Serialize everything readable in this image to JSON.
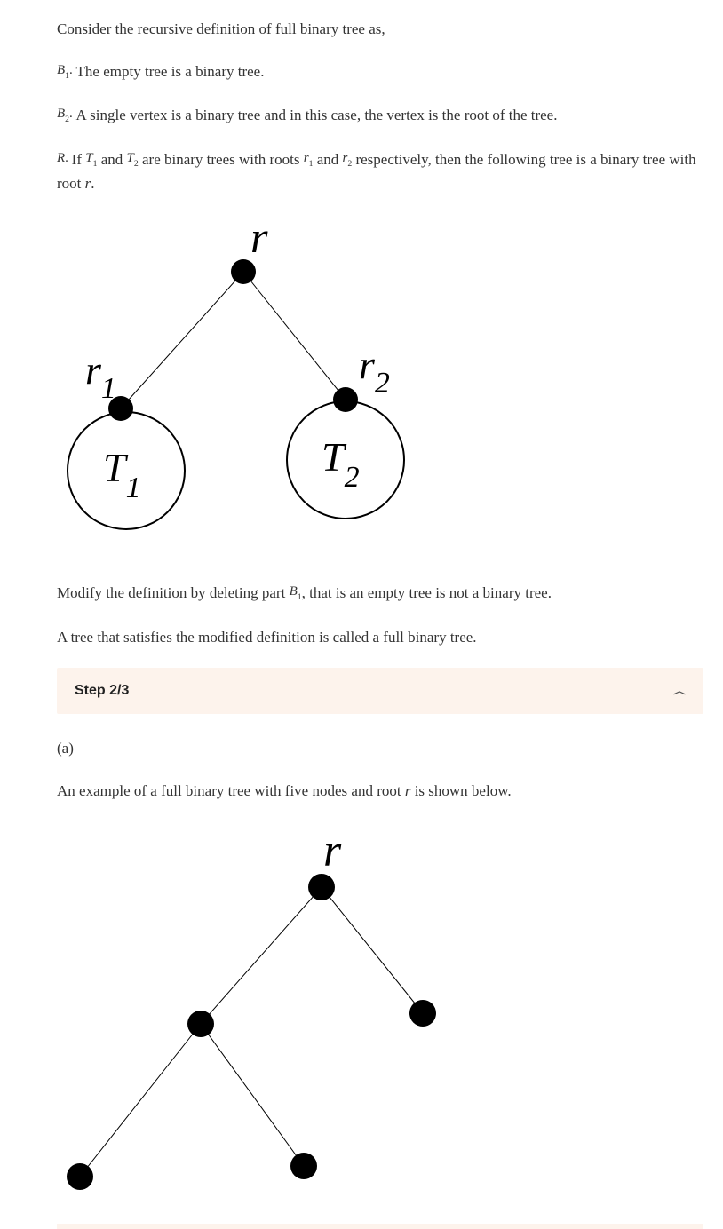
{
  "intro": "Consider the recursive definition of full binary tree as,",
  "b1": {
    "label": "B",
    "sub": "1",
    "dot": ".",
    "text": " The empty tree is a binary tree."
  },
  "b2": {
    "label": "B",
    "sub": "2",
    "dot": ".",
    "text": " A single vertex is a binary tree and in this case, the vertex is the root of the tree."
  },
  "r": {
    "label": "R",
    "dot": ".",
    "if": " If ",
    "T1": "T",
    "T1sub": "1",
    "and1": " and ",
    "T2": "T",
    "T2sub": "2",
    "mid": " are binary trees with roots ",
    "r1": "r",
    "r1sub": "1",
    "and2": " and ",
    "r2": "r",
    "r2sub": "2",
    "tail1": " respectively, then the following tree is a binary tree with root ",
    "rvar": "r",
    "tail2": "."
  },
  "d1": {
    "r": "r",
    "r1": "r",
    "r1sub": "1",
    "r2": "r",
    "r2sub": "2",
    "T1": "T",
    "T1sub": "1",
    "T2": "T",
    "T2sub": "2"
  },
  "modify": {
    "pre": "Modify the definition by deleting part ",
    "B": "B",
    "Bsub": "1",
    "post": ", that is an empty tree is not a binary tree."
  },
  "full_line": "A tree that satisfies the modified definition is called a full binary tree.",
  "step": {
    "title": "Step 2/3"
  },
  "a": {
    "label": "(a)",
    "pre": "An example of a full binary tree with five nodes and root ",
    "rvar": "r",
    "post": " is shown below."
  },
  "d2": {
    "r": "r"
  }
}
